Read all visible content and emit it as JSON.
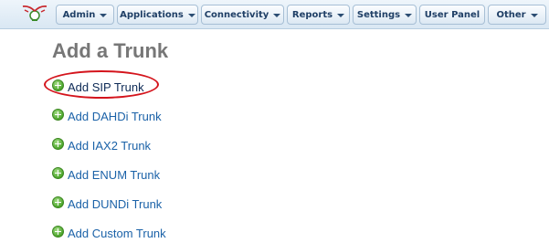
{
  "nav": {
    "items": [
      {
        "label": "Admin",
        "has_dropdown": true
      },
      {
        "label": "Applications",
        "has_dropdown": true
      },
      {
        "label": "Connectivity",
        "has_dropdown": true
      },
      {
        "label": "Reports",
        "has_dropdown": true
      },
      {
        "label": "Settings",
        "has_dropdown": true
      },
      {
        "label": "User Panel",
        "has_dropdown": false
      },
      {
        "label": "Other",
        "has_dropdown": true
      }
    ]
  },
  "page": {
    "title": "Add a Trunk",
    "links": [
      {
        "label": "Add SIP Trunk",
        "icon": "add-icon",
        "highlighted": true
      },
      {
        "label": "Add DAHDi Trunk",
        "icon": "add-icon"
      },
      {
        "label": "Add IAX2 Trunk",
        "icon": "add-icon"
      },
      {
        "label": "Add ENUM Trunk",
        "icon": "add-icon"
      },
      {
        "label": "Add DUNDi Trunk",
        "icon": "add-icon"
      },
      {
        "label": "Add Custom Trunk",
        "icon": "add-icon"
      }
    ]
  },
  "colors": {
    "link": "#1b62a8",
    "annotation": "#d4141c",
    "title": "#777777"
  }
}
